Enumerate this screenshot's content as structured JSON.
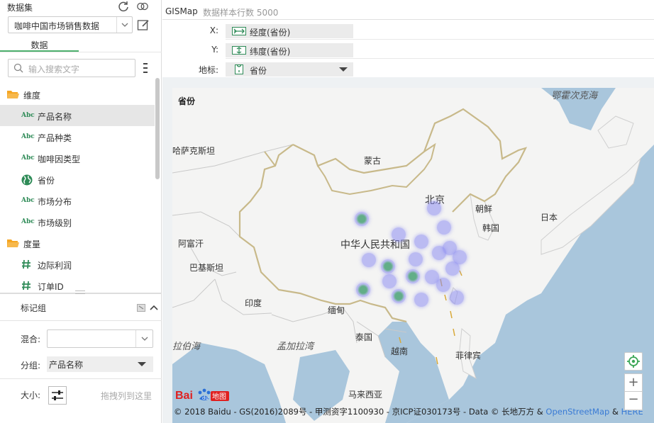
{
  "dataset": {
    "title": "数据集",
    "selected": "咖啡中国市场销售数据",
    "tab": "数据"
  },
  "search": {
    "placeholder": "输入搜索文字"
  },
  "fields": {
    "dimension_group": "维度",
    "dimensions": [
      "产品名称",
      "产品种类",
      "咖啡因类型",
      "省份",
      "市场分布",
      "市场级别"
    ],
    "measure_group": "度量",
    "measures": [
      "边际利润",
      "订单ID"
    ]
  },
  "marks": {
    "title": "标记组",
    "mix_label": "混合:",
    "mix_value": "",
    "group_label": "分组:",
    "group_value": "产品名称",
    "size_label": "大小:",
    "drag_hint": "拖拽列到这里"
  },
  "chart": {
    "type": "GISMap",
    "sample_rows": "数据样本行数 5000",
    "x_label": "X:",
    "x_value": "经度(省份)",
    "y_label": "Y:",
    "y_value": "纬度(省份)",
    "addr_label": "地标:",
    "addr_value": "省份"
  },
  "map": {
    "legend_title": "省份",
    "labels": {
      "okhotsk": "鄂霍次克海",
      "kazakhstan": "哈萨克斯坦",
      "mongolia": "蒙古",
      "beijing": "北京",
      "nkorea": "朝鲜",
      "skorea": "韩国",
      "japan": "日本",
      "china": "中华人民共和国",
      "afghanistan": "阿富汗",
      "pakistan": "巴基斯坦",
      "india": "印度",
      "myanmar": "缅甸",
      "thailand": "泰国",
      "vietnam": "越南",
      "philippines": "菲律宾",
      "arabian_sea": "拉伯海",
      "bay_of_bengal": "孟加拉湾",
      "malaysia": "马来西亚"
    },
    "copyright_prefix": "© 2018 Baidu - GS(2016)2089号 - 甲测资字1100930 - 京ICP证030173号 - Data © 长地万方 & ",
    "copyright_osm": "OpenStreetMap",
    "copyright_and": " & ",
    "copyright_here": "HERE",
    "logo_text": "Bai",
    "logo_text2": "地图",
    "zoom_in": "+",
    "zoom_out": "−"
  },
  "colors": {
    "accent": "#4db06e",
    "bubble": "#8c8cf0",
    "border_china": "#c8b98a",
    "sea": "#a9c6dc",
    "land": "#f4f4f3"
  }
}
